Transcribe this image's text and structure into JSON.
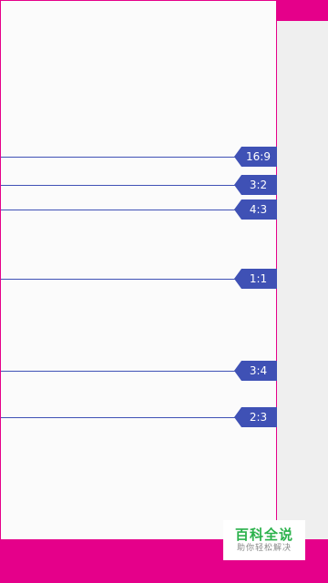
{
  "colors": {
    "accent": "#e5008a",
    "guide": "#3f51b5",
    "panel": "#fbfbfb",
    "side": "#efefef"
  },
  "ratio_guides": [
    {
      "label": "16:9"
    },
    {
      "label": "3:2"
    },
    {
      "label": "4:3"
    },
    {
      "label": "1:1"
    },
    {
      "label": "3:4"
    },
    {
      "label": "2:3"
    }
  ],
  "watermark": {
    "title": "百科全说",
    "subtitle": "助你轻松解决"
  }
}
